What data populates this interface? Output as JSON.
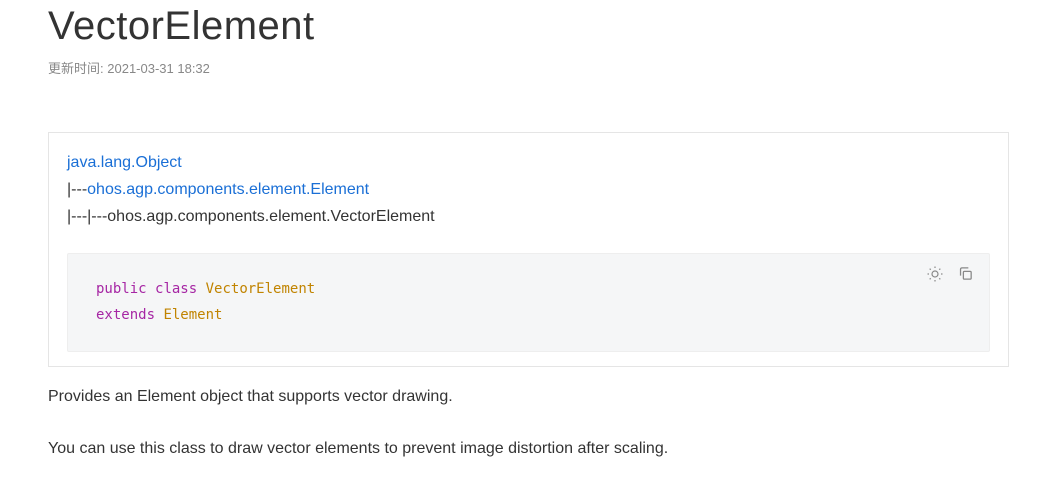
{
  "title": "VectorElement",
  "updateLabel": "更新时间:",
  "updateTime": "2021-03-31 18:32",
  "hierarchy": {
    "root": "java.lang.Object",
    "branch1_prefix": "|---",
    "branch1_text": "ohos.agp.components.element.Element",
    "branch2_prefix": "|---|---",
    "branch2_text": "ohos.agp.components.element.VectorElement"
  },
  "code": {
    "kw_public": "public",
    "kw_class": "class",
    "class_name": "VectorElement",
    "kw_extends": "extends",
    "super_name": "Element"
  },
  "icons": {
    "theme": "theme-toggle",
    "copy": "copy"
  },
  "paragraphs": {
    "p1": "Provides an Element object that supports vector drawing.",
    "p2": "You can use this class to draw vector elements to prevent image distortion after scaling."
  }
}
